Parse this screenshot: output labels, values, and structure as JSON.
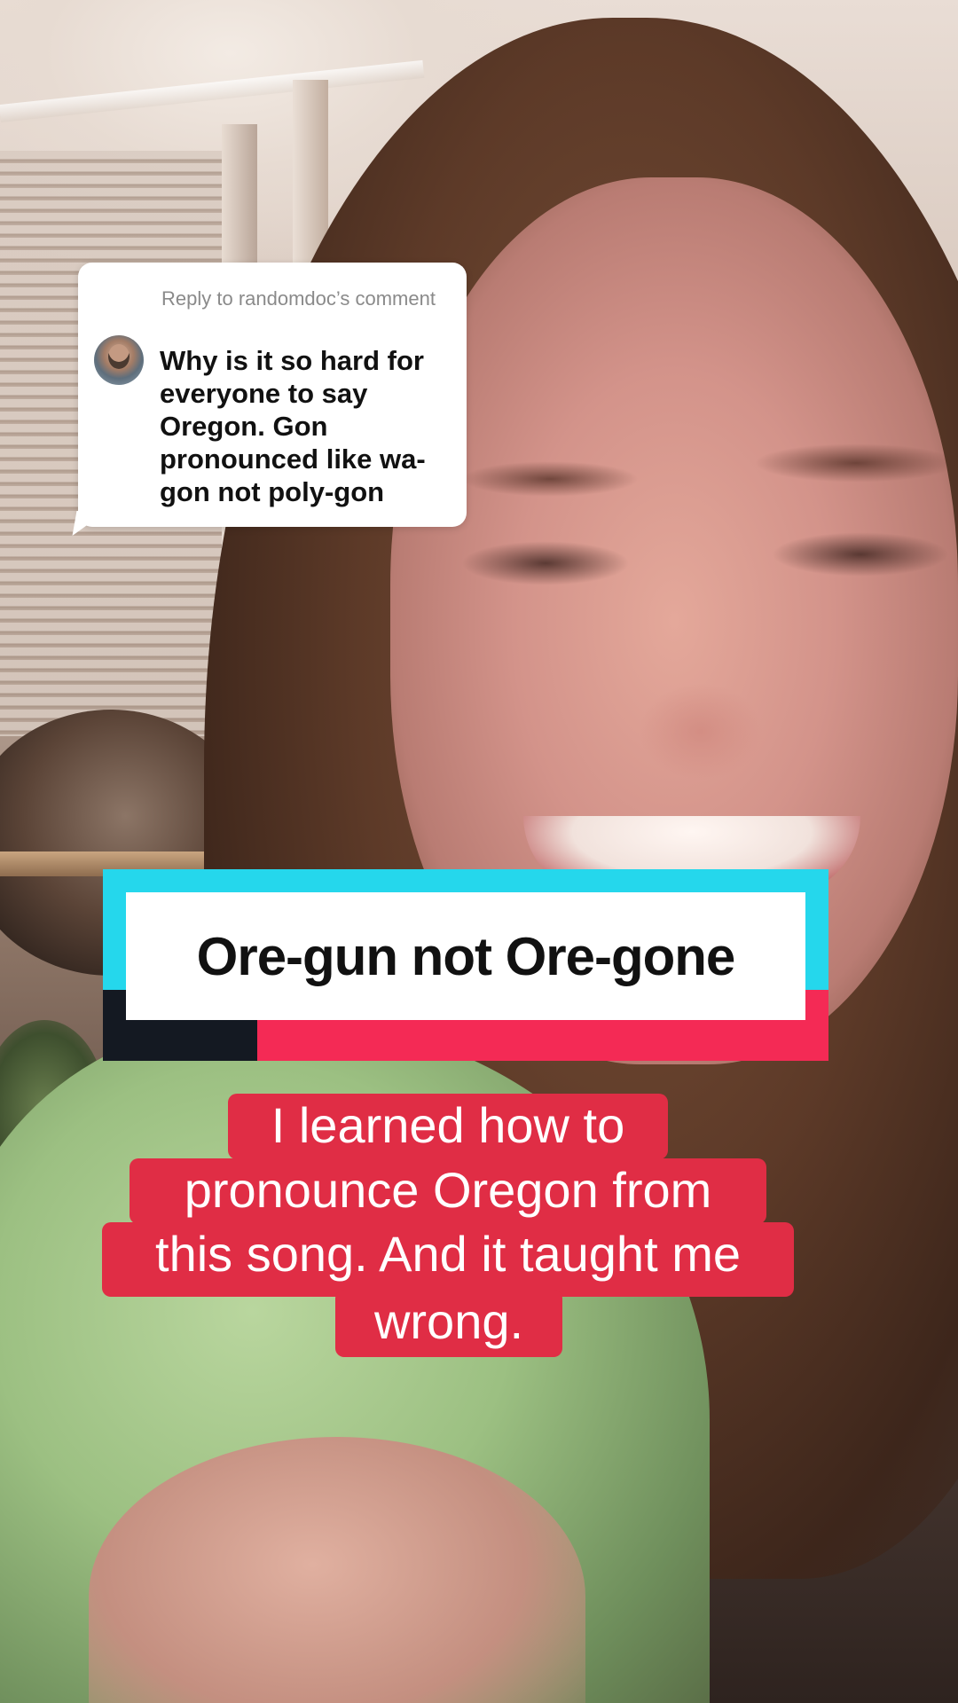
{
  "reply_sticker": {
    "header": "Reply to randomdoc’s comment",
    "comment_text": "Why is it so hard for everyone to say Oregon. Gon pronounced like wa-gon not poly-gon"
  },
  "title_banner": {
    "text": "Ore-gun not Ore-gone",
    "colors": {
      "cyan": "#25d7ec",
      "red": "#f42a55",
      "dark": "#141922"
    }
  },
  "caption": {
    "lines": [
      "I learned how to",
      "pronounce Oregon from",
      "this song. And it taught me",
      "wrong."
    ],
    "background_color": "#e02d45"
  }
}
